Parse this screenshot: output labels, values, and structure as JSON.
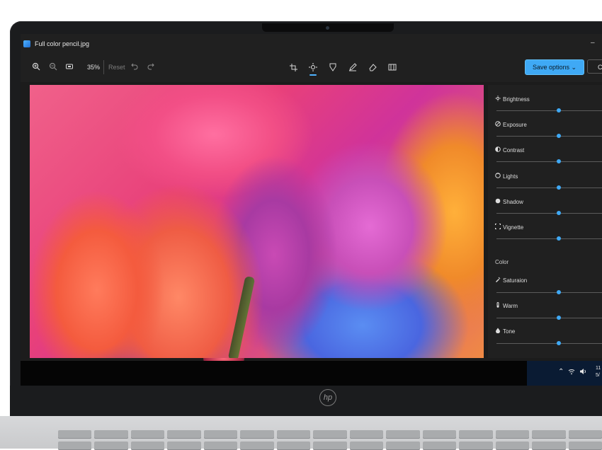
{
  "app": {
    "window_title": "Full color pencil.jpg"
  },
  "toolbar": {
    "zoom_in_icon": "zoom-in-icon",
    "zoom_out_icon": "zoom-out-icon",
    "fit_icon": "fit-to-window-icon",
    "zoom_level": "35%",
    "reset_label": "Reset",
    "undo_icon": "undo-icon",
    "redo_icon": "redo-icon",
    "tools": [
      "crop-icon",
      "adjust-brightness-icon",
      "filter-icon",
      "markup-pen-icon",
      "erase-icon",
      "background-icon"
    ],
    "save_label": "Save options",
    "extra_label": "C"
  },
  "panel": {
    "light_items": [
      {
        "label": "Brightness",
        "icon": "brightness-icon",
        "value": 0.55
      },
      {
        "label": "Exposure",
        "icon": "exposure-icon",
        "value": 0.55
      },
      {
        "label": "Contrast",
        "icon": "contrast-icon",
        "value": 0.55
      },
      {
        "label": "Lights",
        "icon": "lights-icon",
        "value": 0.55
      },
      {
        "label": "Shadow",
        "icon": "shadow-icon",
        "value": 0.55
      },
      {
        "label": "Vignette",
        "icon": "vignette-icon",
        "value": 0.55
      }
    ],
    "color_section_title": "Color",
    "color_items": [
      {
        "label": "Saturaion",
        "icon": "saturation-icon",
        "value": 0.55
      },
      {
        "label": "Warm",
        "icon": "warmth-icon",
        "value": 0.55
      },
      {
        "label": "Tone",
        "icon": "tone-icon",
        "value": 0.55
      }
    ]
  },
  "taskbar": {
    "clock_time": "11",
    "clock_date": "5/"
  },
  "colors": {
    "accent": "#3fa9f5",
    "panel_bg": "#202020"
  }
}
